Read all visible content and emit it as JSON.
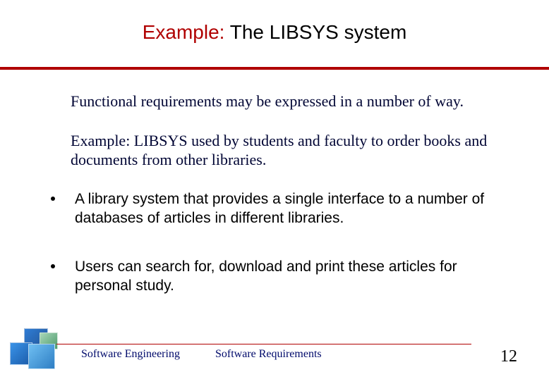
{
  "title": {
    "accent": "Example:",
    "rest": " The LIBSYS system"
  },
  "intro": {
    "p1": "Functional requirements may be expressed in a number of way.",
    "p2": "Example: LIBSYS used by students and faculty to order books and documents from other libraries."
  },
  "bullets": [
    "A library system that provides a single interface to a number of databases of articles in different libraries.",
    "Users can search for, download and print these articles for personal study."
  ],
  "footer": {
    "left": "Software Engineering",
    "center": "Software Requirements",
    "page": "12"
  }
}
